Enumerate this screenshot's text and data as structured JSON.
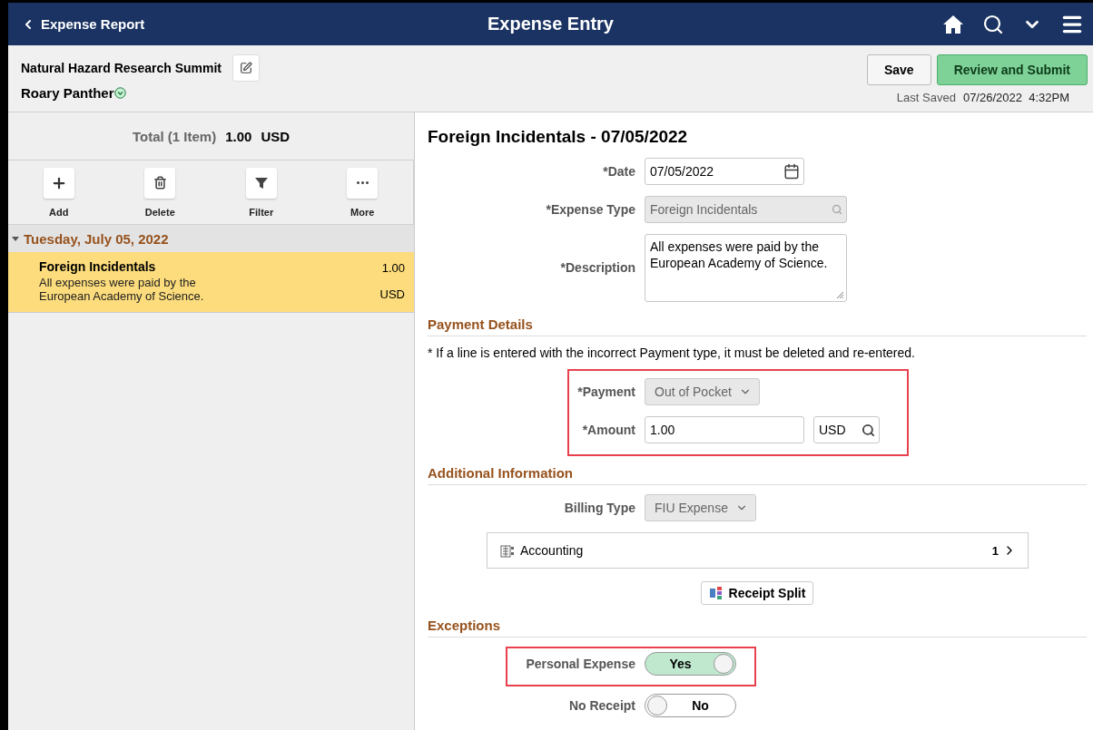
{
  "header": {
    "back_label": "Expense Report",
    "title": "Expense Entry"
  },
  "report": {
    "name": "Natural Hazard Research Summit",
    "owner": "Roary Panther",
    "save": "Save",
    "submit": "Review and Submit",
    "last_saved_label": "Last Saved",
    "last_saved_value": "07/26/2022  4:32PM"
  },
  "summary": {
    "label": "Total (1 Item)",
    "amount": "1.00",
    "currency": "USD"
  },
  "toolbar": [
    {
      "kind": "add",
      "label": "Add"
    },
    {
      "kind": "delete",
      "label": "Delete"
    },
    {
      "kind": "filter",
      "label": "Filter"
    },
    {
      "kind": "more",
      "label": "More"
    }
  ],
  "groups": [
    {
      "date": "Tuesday, July 05, 2022",
      "expanded": true,
      "items": [
        {
          "title": "Foreign Incidentals",
          "description": "All expenses were paid by the European Academy of Science.",
          "amount": "1.00",
          "currency": "USD",
          "selected": true
        }
      ]
    }
  ],
  "detail": {
    "title": "Foreign Incidentals - 07/05/2022",
    "fields": [
      {
        "kind": "date",
        "label": "*Date",
        "value": "07/05/2022"
      },
      {
        "kind": "lookup",
        "label": "*Expense Type",
        "value": "Foreign Incidentals",
        "disabled": true
      },
      {
        "kind": "textarea",
        "label": "*Description",
        "value": "All expenses were paid by the European Academy of Science."
      }
    ],
    "sections": [
      {
        "title": "Payment Details",
        "note": "* If a line is entered with the incorrect Payment type, it must be deleted and re-entered.",
        "highlighted": true,
        "rows": [
          {
            "kind": "select",
            "label": "*Payment",
            "value": "Out of Pocket"
          },
          {
            "kind": "amount",
            "label": "*Amount",
            "value": "1.00",
            "currency": "USD"
          }
        ]
      },
      {
        "title": "Additional Information",
        "rows": [
          {
            "kind": "select",
            "label": "Billing Type",
            "value": "FIU Expense"
          },
          {
            "kind": "link",
            "label": "Accounting",
            "count": "1"
          },
          {
            "kind": "button",
            "label": "Receipt Split"
          }
        ]
      },
      {
        "title": "Exceptions",
        "rows": [
          {
            "kind": "toggle",
            "label": "Personal Expense",
            "on": true,
            "on_text": "Yes",
            "highlighted": true
          },
          {
            "kind": "toggle",
            "label": "No Receipt",
            "on": false,
            "off_text": "No",
            "highlighted": false
          }
        ]
      }
    ]
  }
}
